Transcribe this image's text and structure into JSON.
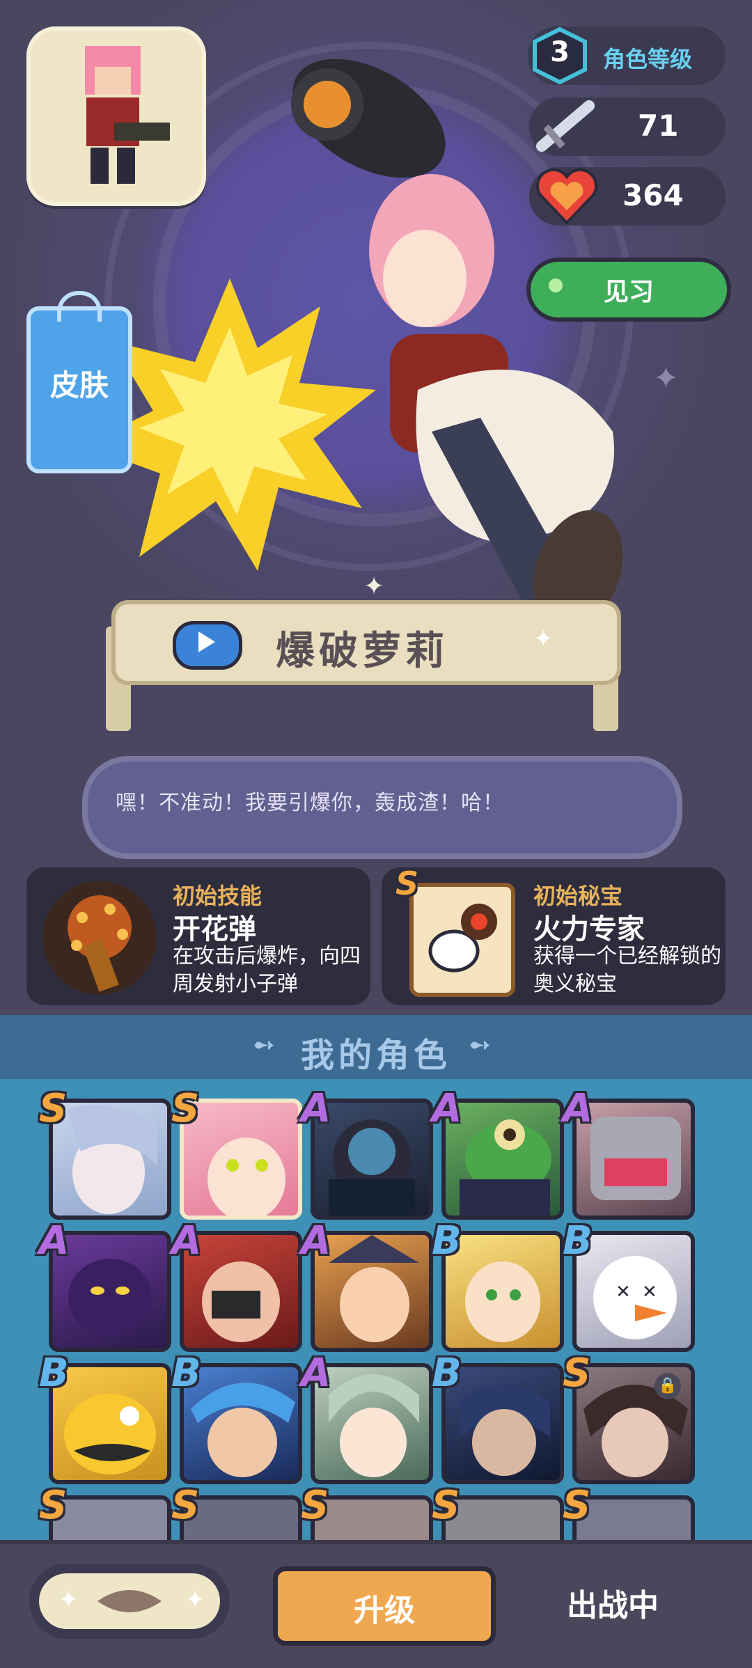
{
  "character": {
    "name": "爆破萝莉",
    "quote": "嘿！不准动！我要引爆你，轰成渣！哈！",
    "skin_label": "皮肤",
    "status_button": "见习"
  },
  "stats": {
    "level": "3",
    "level_label": "角色等级",
    "attack": "71",
    "hp": "364"
  },
  "initial_skill": {
    "category": "初始技能",
    "name": "开花弹",
    "description": "在攻击后爆炸，向四周发射小子弹"
  },
  "initial_treasure": {
    "grade": "S",
    "category": "初始秘宝",
    "name": "火力专家",
    "description": "获得一个已经解锁的奥义秘宝"
  },
  "roster": {
    "title": "我的角色",
    "rows": [
      [
        "S",
        "S",
        "A",
        "A",
        "A"
      ],
      [
        "A",
        "A",
        "A",
        "B",
        "B"
      ],
      [
        "B",
        "B",
        "A",
        "B",
        "S"
      ],
      [
        "S",
        "S",
        "S",
        "S",
        "S"
      ]
    ]
  },
  "bottom": {
    "upgrade": "升级",
    "deploy": "出战中"
  },
  "colors": {
    "grade_S": "#f4a640",
    "grade_A": "#b36ce0",
    "grade_B": "#62b6ea",
    "trainee_green": "#3fae5a",
    "upgrade_orange": "#f0a850"
  }
}
